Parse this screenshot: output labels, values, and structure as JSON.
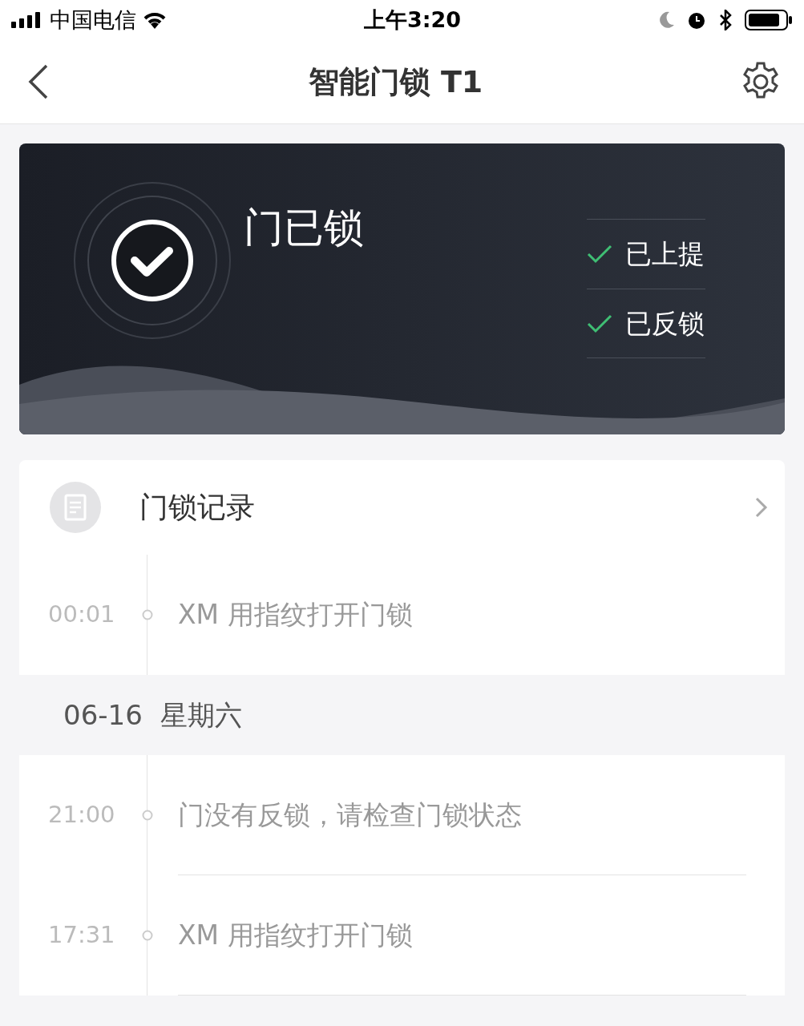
{
  "status_bar": {
    "carrier": "中国电信",
    "time": "上午3:20"
  },
  "header": {
    "title": "智能门锁 T1"
  },
  "lock_status": {
    "title": "门已锁",
    "locked": true,
    "checks": [
      {
        "label": "已上提",
        "checked": true
      },
      {
        "label": "已反锁",
        "checked": true
      }
    ]
  },
  "records": {
    "title": "门锁记录"
  },
  "log_groups": [
    {
      "entries": [
        {
          "time": "00:01",
          "text": "XM 用指纹打开门锁"
        }
      ]
    },
    {
      "date": "06-16",
      "weekday": "星期六",
      "entries": [
        {
          "time": "21:00",
          "text": "门没有反锁，请检查门锁状态"
        },
        {
          "time": "17:31",
          "text": "XM 用指纹打开门锁"
        }
      ]
    }
  ]
}
